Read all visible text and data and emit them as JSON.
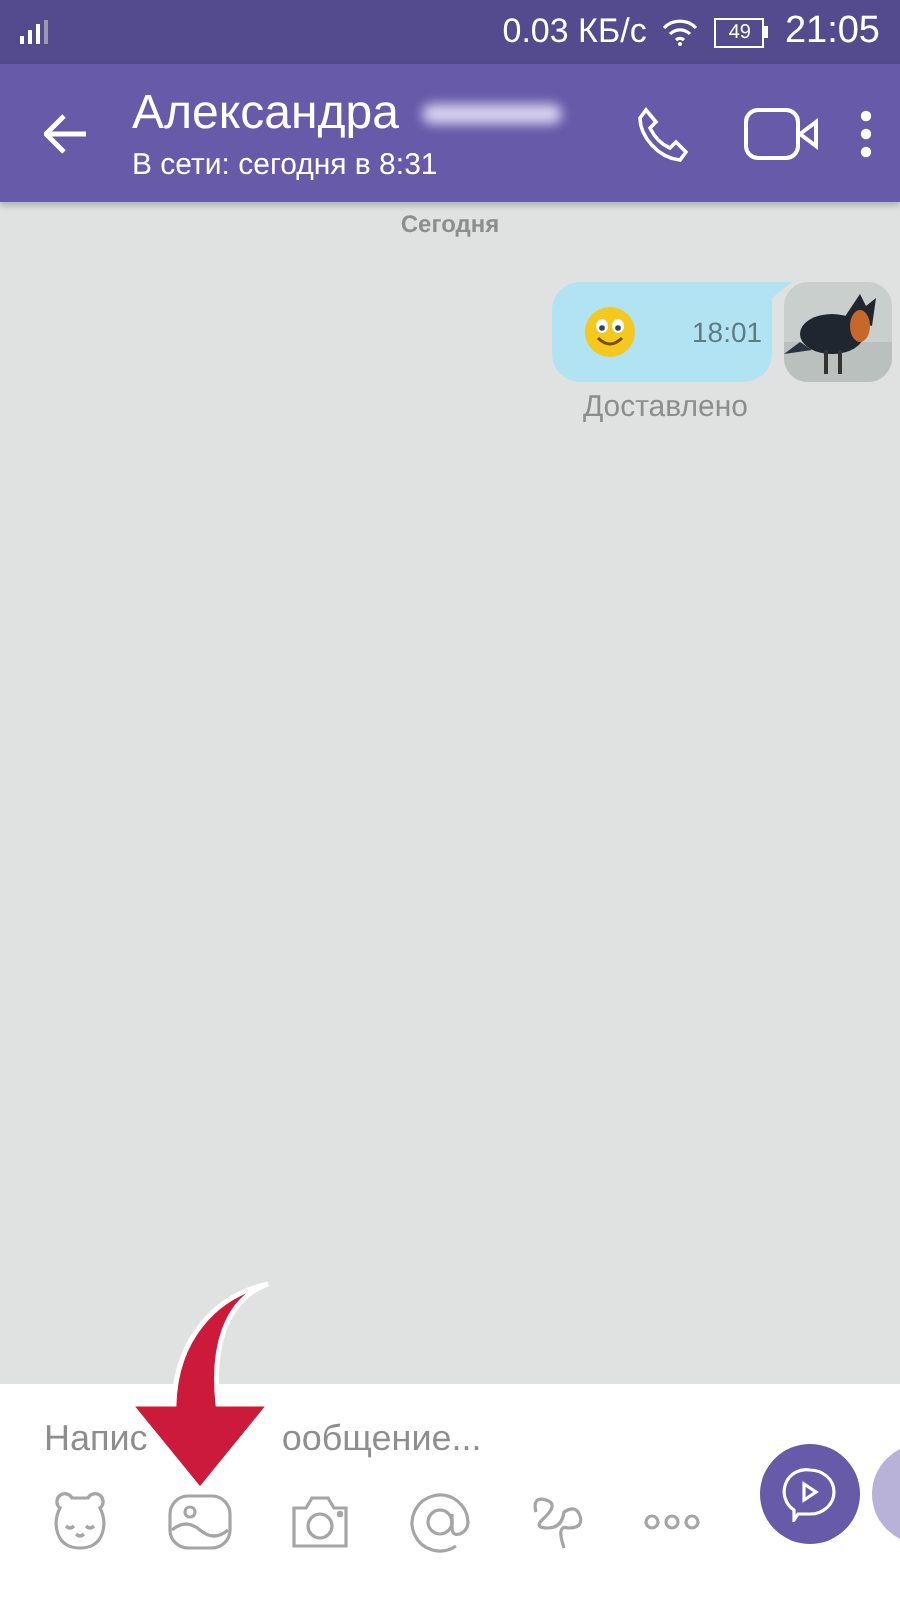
{
  "status_bar": {
    "speed": "0.03 КБ/с",
    "battery": "49",
    "time": "21:05"
  },
  "header": {
    "title": "Александра",
    "subtitle": "В сети: сегодня в 8:31"
  },
  "chat": {
    "date_separator": "Сегодня",
    "messages": [
      {
        "time": "18:01",
        "status": "Доставлено"
      }
    ]
  },
  "composer": {
    "placeholder_parts": [
      "Напис",
      "ообщение..."
    ]
  }
}
